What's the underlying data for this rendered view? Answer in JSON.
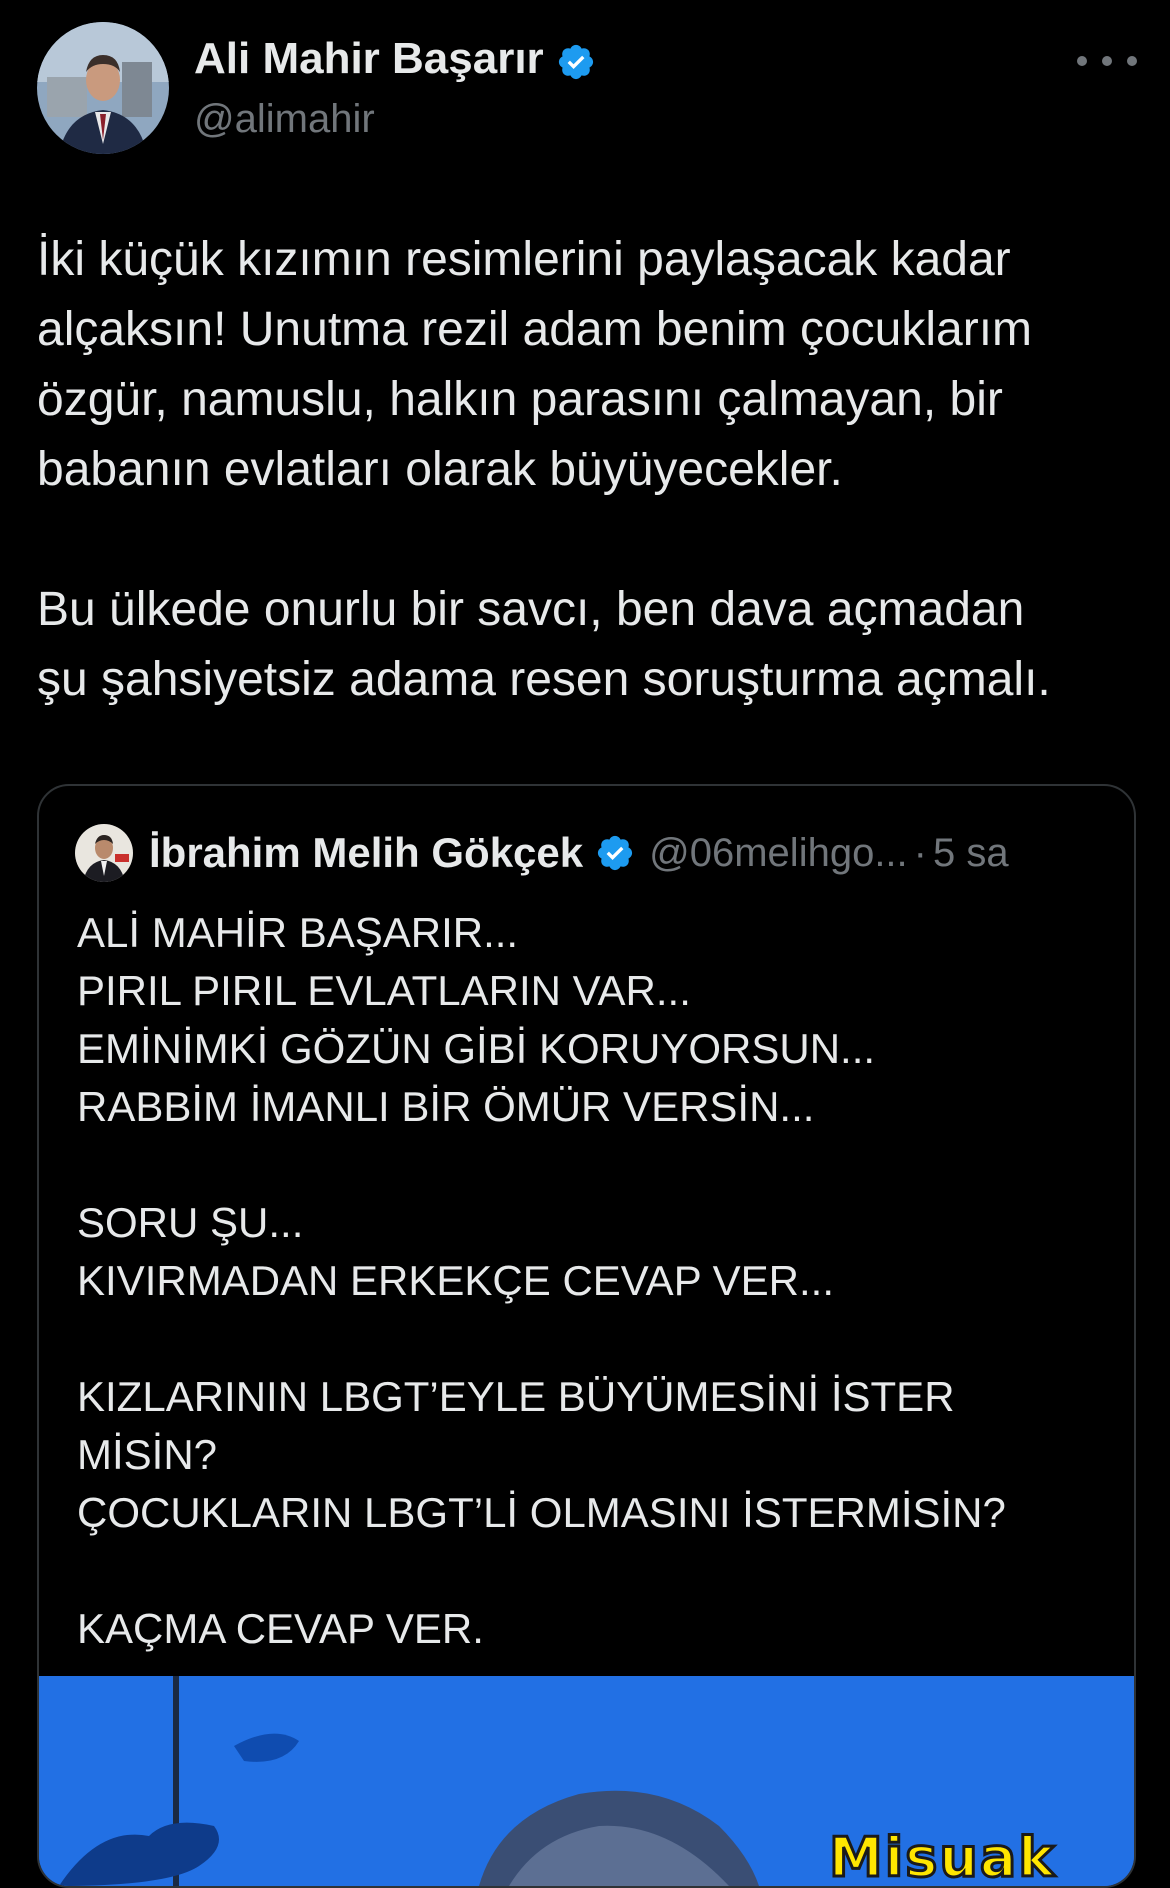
{
  "author": {
    "display_name": "Ali Mahir Başarır",
    "handle": "@alimahir",
    "verified": true,
    "verified_color": "#1d9bf0"
  },
  "menu": {
    "icon": "more-horizontal-icon"
  },
  "tweet": {
    "text": "İki küçük kızımın resimlerini paylaşacak kadar\nalçaksın! Unutma rezil adam benim çocuklarım\nözgür,  namuslu, halkın parasını çalmayan, bir\nbabanın evlatları olarak büyüyecekler.\n\nBu ülkede onurlu bir savcı, ben dava açmadan\nşu şahsiyetsiz adama resen soruşturma açmalı."
  },
  "quoted_tweet": {
    "display_name": "İbrahim Melih Gökçek",
    "verified": true,
    "handle": "@06melihgo...",
    "separator": "·",
    "time": "5 sa",
    "text": "ALİ MAHİR BAŞARIR...\nPIRIL PIRIL EVLATLARIN VAR...\nEMİNİMKİ GÖZÜN GİBİ KORUYORSUN...\nRABBİM İMANLI BİR ÖMÜR VERSİN...\n\nSORU ŞU...\nKIVIRMADAN ERKEKÇE CEVAP VER...\n\nKIZLARININ LBGT’EYLE BÜYÜMESİNİ İSTER\nMİSİN?\nÇOCUKLARIN LBGT’Lİ  OLMASINI İSTERMİSİN?\n\nKAÇMA CEVAP VER.",
    "media": {
      "visible_text": "Misuak"
    }
  },
  "colors": {
    "background": "#000000",
    "text_primary": "#e7e9ea",
    "text_secondary": "#71767b",
    "border": "#2f3336",
    "media_blue": "#1e6ce0",
    "media_yellow": "#ffe600"
  }
}
